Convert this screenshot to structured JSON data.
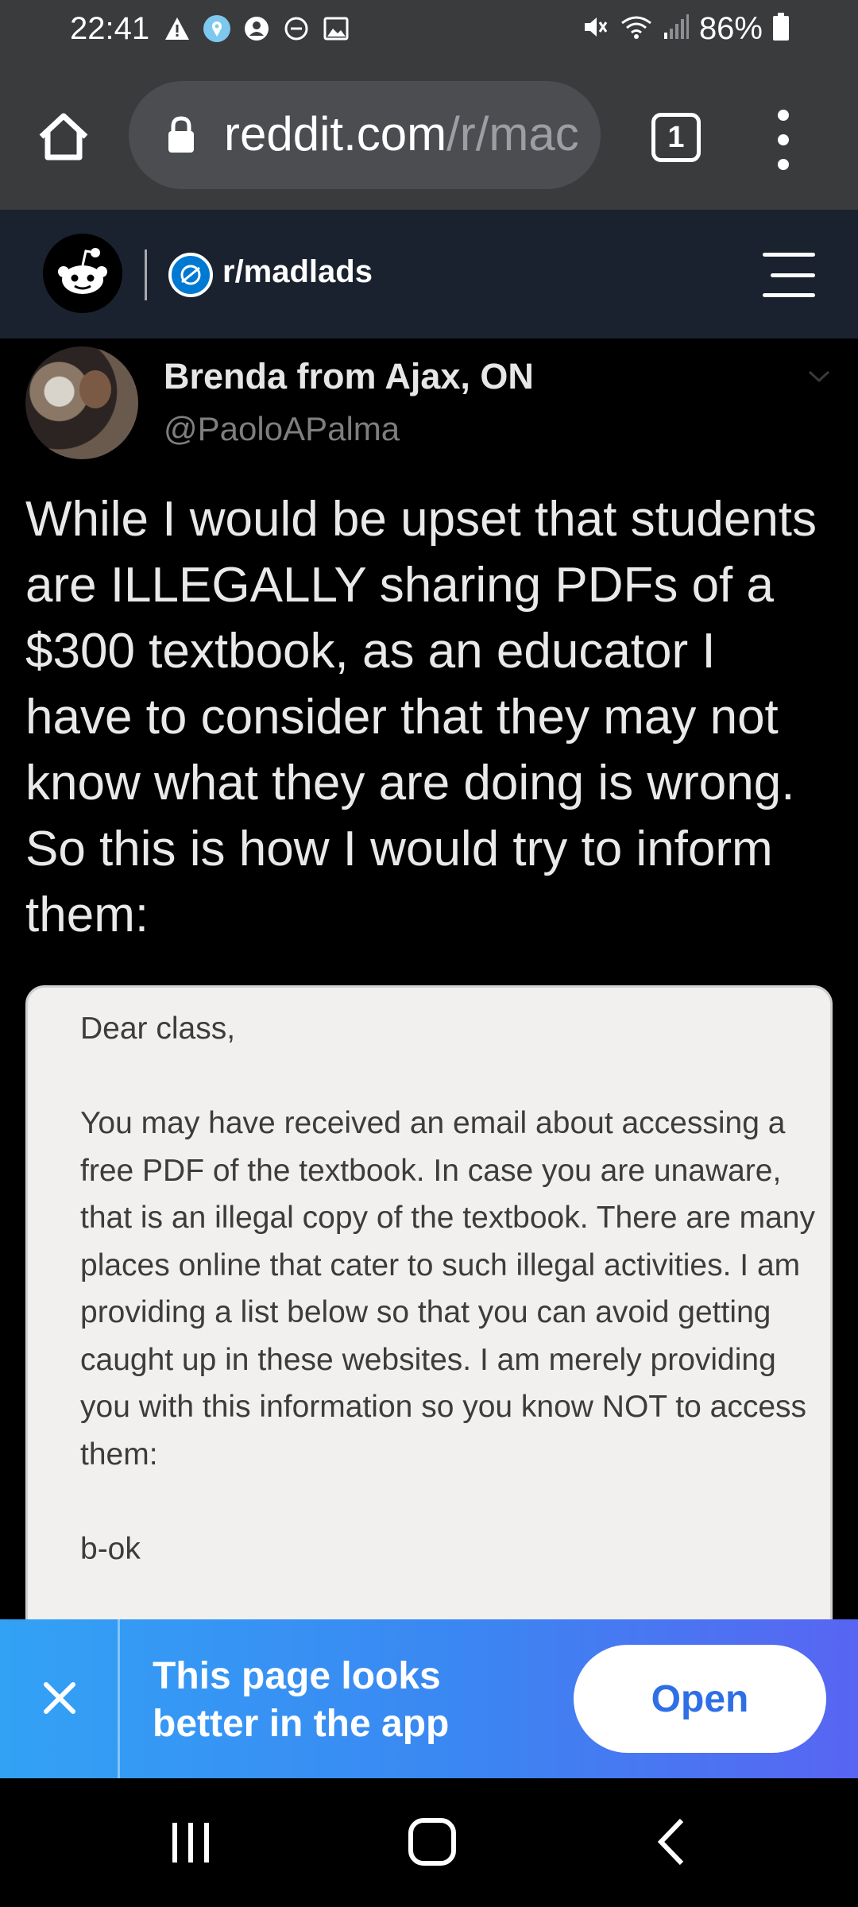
{
  "status_bar": {
    "time": "22:41",
    "battery": "86%",
    "icons_left": [
      "warning-icon",
      "location-icon",
      "account-icon",
      "dnd-icon",
      "image-icon"
    ],
    "icons_right": [
      "mute-icon",
      "wifi-icon",
      "signal-icon",
      "battery-icon"
    ]
  },
  "browser": {
    "url_domain": "reddit.com",
    "url_path": "/r/mac",
    "tab_count": "1"
  },
  "reddit_header": {
    "subreddit": "r/madlads"
  },
  "tweet": {
    "author_name": "Brenda from Ajax, ON",
    "author_handle": "@PaoloAPalma",
    "text": "While I would be upset that students are ILLEGALLY sharing PDFs of a $300 textbook, as an educator I have to consider that they may not know what they are doing is wrong. So this is how I would try to inform them:",
    "note": "Dear class,\n\nYou may have received an email about accessing a free PDF of the textbook. In case you are unaware, that is an illegal copy of the textbook. There are many places online that cater to such illegal activities. I am providing a list below so that you can avoid getting caught up in these websites. I am merely providing you with this information so you know NOT to access them:\n\nb-ok"
  },
  "app_banner": {
    "message": "This page looks better in the app",
    "open_label": "Open"
  },
  "colors": {
    "status_bg": "#3a3b3d",
    "reddit_header_bg": "#1a2230",
    "banner_start": "#32a2f5",
    "banner_end": "#5865f2",
    "open_text": "#2f6fe6"
  }
}
